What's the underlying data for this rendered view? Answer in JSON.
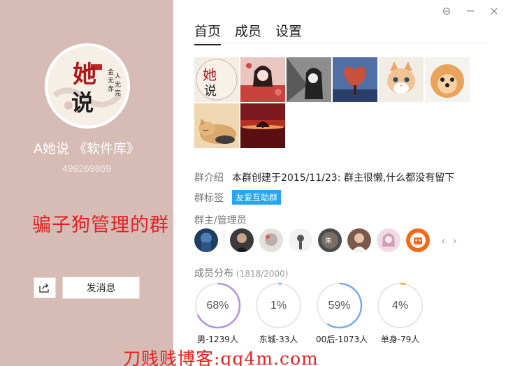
{
  "window": {
    "controls": [
      "⌂",
      "—",
      "✕"
    ]
  },
  "group": {
    "name": "A她说 《软件库》",
    "id": "499269869",
    "avatar_text": "她说"
  },
  "left_actions": {
    "send_label": "发消息"
  },
  "tabs": [
    {
      "label": "首页"
    },
    {
      "label": "成员"
    },
    {
      "label": "设置"
    }
  ],
  "photos": [
    {
      "name": "group-logo"
    },
    {
      "name": "red-girl"
    },
    {
      "name": "bw-girl"
    },
    {
      "name": "heart-tree"
    },
    {
      "name": "kitten"
    },
    {
      "name": "pomeranian"
    },
    {
      "name": "sleeping-cat"
    },
    {
      "name": "sunset-tree"
    }
  ],
  "intro": {
    "label": "群介绍",
    "text": "本群创建于2015/11/23:  群主很懒,什么都没有留下"
  },
  "tags": {
    "label": "群标签",
    "items": [
      "友爱互助群"
    ]
  },
  "admins": {
    "label": "群主/管理员",
    "prev": "‹",
    "next": "›"
  },
  "distribution": {
    "label": "成员分布",
    "count": "(1818/2000)",
    "stats": [
      {
        "percent_text": "68%",
        "label": "男-1239人",
        "value": 0.68,
        "color": "#b390e6"
      },
      {
        "percent_text": "1%",
        "label": "东城-33人",
        "value": 0.01,
        "color": "#7aa7f0"
      },
      {
        "percent_text": "59%",
        "label": "00后-1073人",
        "value": 0.59,
        "color": "#7aa7f0"
      },
      {
        "percent_text": "4%",
        "label": "单身-79人",
        "value": 0.04,
        "color": "#f5a623"
      }
    ]
  },
  "watermarks": {
    "left": "骗子狗管理的群",
    "bottom": "刀贱贱博客:qq4m.com"
  }
}
